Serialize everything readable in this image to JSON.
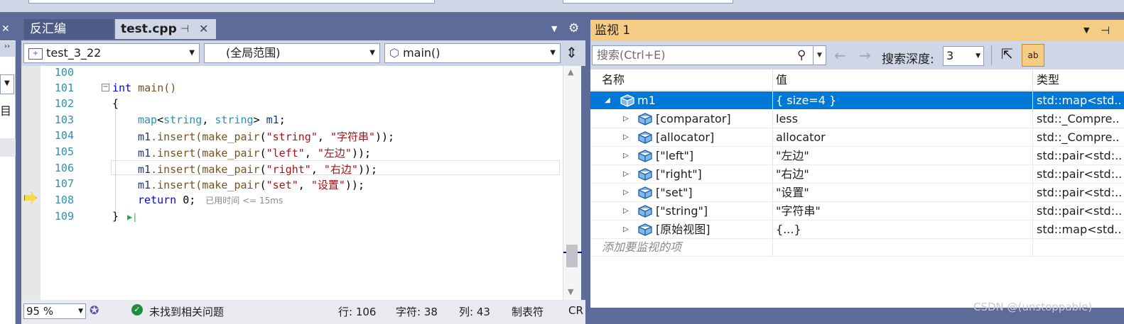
{
  "editor": {
    "tabs": [
      {
        "label": "反汇编"
      },
      {
        "label": "test.cpp"
      }
    ],
    "nav": {
      "project": "test_3_22",
      "scope": "(全局范围)",
      "member": "main()"
    },
    "lines": [
      {
        "num": "100"
      },
      {
        "num": "101"
      },
      {
        "num": "102"
      },
      {
        "num": "103"
      },
      {
        "num": "104"
      },
      {
        "num": "105"
      },
      {
        "num": "106"
      },
      {
        "num": "107"
      },
      {
        "num": "108"
      },
      {
        "num": "109"
      }
    ],
    "code": {
      "l101_kw": "int",
      "l101_rest": " main()",
      "l102": "{",
      "l103_a": "map",
      "l103_b": "<",
      "l103_c": "string",
      "l103_d": ", ",
      "l103_e": "string",
      "l103_f": "> ",
      "l103_g": "m1",
      "l103_h": ";",
      "insert_obj": "m1",
      "insert_fn": ".insert(",
      "make_pair": "make_pair",
      "l104_k": "\"string\"",
      "l104_v": "\"字符串\"",
      "l105_k": "\"left\"",
      "l105_v": "\"左边\"",
      "l106_k": "\"right\"",
      "l106_v": "\"右边\"",
      "l107_k": "\"set\"",
      "l107_v": "\"设置\"",
      "l108_kw": "return",
      "l108_rest": " 0;",
      "l108_hint": "已用时间 <= 15ms",
      "l109": "}"
    },
    "status": {
      "zoom": "95 %",
      "issues": "未找到相关问题",
      "line": "行: 106",
      "char": "字符: 38",
      "col": "列: 43",
      "tabs": "制表符",
      "eol": "CR"
    }
  },
  "watch": {
    "title": "监视 1",
    "search_placeholder": "搜索(Ctrl+E)",
    "depth_label": "搜索深度:",
    "depth_value": "3",
    "columns": {
      "name": "名称",
      "value": "值",
      "type": "类型"
    },
    "rows": [
      {
        "name": "m1",
        "value": "{ size=4 }",
        "type": "std::map<std.."
      },
      {
        "name": "[comparator]",
        "value": "less",
        "type": "std::_Compre.."
      },
      {
        "name": "[allocator]",
        "value": "allocator",
        "type": "std::_Compre.."
      },
      {
        "name": "[\"left\"]",
        "value": "\"左边\"",
        "type": "std::pair<std:.."
      },
      {
        "name": "[\"right\"]",
        "value": "\"右边\"",
        "type": "std::pair<std:.."
      },
      {
        "name": "[\"set\"]",
        "value": "\"设置\"",
        "type": "std::pair<std:.."
      },
      {
        "name": "[\"string\"]",
        "value": "\"字符串\"",
        "type": "std::pair<std:.."
      },
      {
        "name": "[原始视图]",
        "value": "{...}",
        "type": "std::map<std.."
      }
    ],
    "add_item": "添加要监视的项"
  },
  "left": {
    "label": "目"
  },
  "watermark": "CSDN @(unstoppable)",
  "colors": {
    "accent": "#0078d7",
    "title_bar": "#f5cc84",
    "chrome": "#5d6b99"
  }
}
